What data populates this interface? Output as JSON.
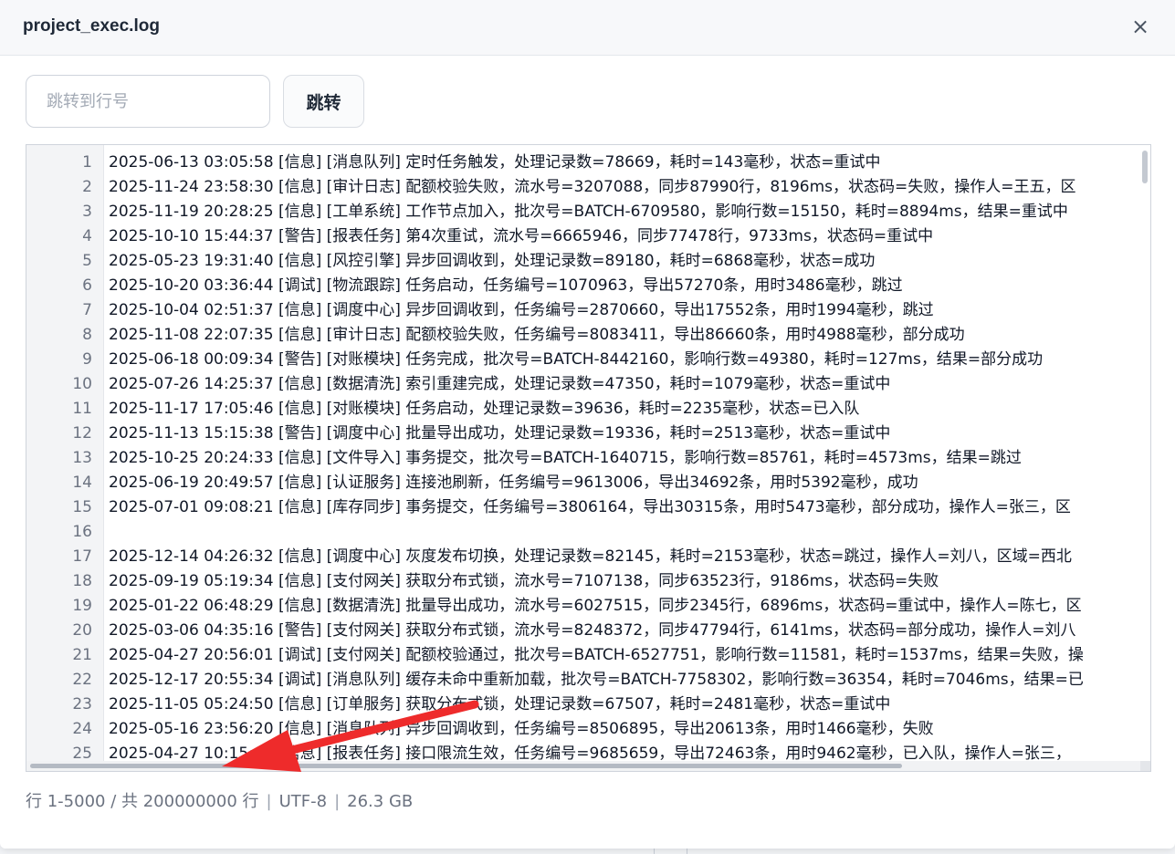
{
  "dialog": {
    "title": "project_exec.log",
    "close_glyph": "×"
  },
  "jump": {
    "placeholder": "跳转到行号",
    "button_label": "跳转"
  },
  "log_lines": [
    {
      "n": "1",
      "text": "2025-06-13 03:05:58 [信息] [消息队列] 定时任务触发，处理记录数=78669，耗时=143毫秒，状态=重试中"
    },
    {
      "n": "2",
      "text": "2025-11-24 23:58:30 [信息] [审计日志] 配额校验失败，流水号=3207088，同步87990行，8196ms，状态码=失败，操作人=王五，区"
    },
    {
      "n": "3",
      "text": "2025-11-19 20:28:25 [信息] [工单系统] 工作节点加入，批次号=BATCH-6709580，影响行数=15150，耗时=8894ms，结果=重试中"
    },
    {
      "n": "4",
      "text": "2025-10-10 15:44:37 [警告] [报表任务] 第4次重试，流水号=6665946，同步77478行，9733ms，状态码=重试中"
    },
    {
      "n": "5",
      "text": "2025-05-23 19:31:40 [信息] [风控引擎] 异步回调收到，处理记录数=89180，耗时=6868毫秒，状态=成功"
    },
    {
      "n": "6",
      "text": "2025-10-20 03:36:44 [调试] [物流跟踪] 任务启动，任务编号=1070963，导出57270条，用时3486毫秒，跳过"
    },
    {
      "n": "7",
      "text": "2025-10-04 02:51:37 [信息] [调度中心] 异步回调收到，任务编号=2870660，导出17552条，用时1994毫秒，跳过"
    },
    {
      "n": "8",
      "text": "2025-11-08 22:07:35 [信息] [审计日志] 配额校验失败，任务编号=8083411，导出86660条，用时4988毫秒，部分成功"
    },
    {
      "n": "9",
      "text": "2025-06-18 00:09:34 [警告] [对账模块] 任务完成，批次号=BATCH-8442160，影响行数=49380，耗时=127ms，结果=部分成功"
    },
    {
      "n": "10",
      "text": "2025-07-26 14:25:37 [信息] [数据清洗] 索引重建完成，处理记录数=47350，耗时=1079毫秒，状态=重试中"
    },
    {
      "n": "11",
      "text": "2025-11-17 17:05:46 [信息] [对账模块] 任务启动，处理记录数=39636，耗时=2235毫秒，状态=已入队"
    },
    {
      "n": "12",
      "text": "2025-11-13 15:15:38 [警告] [调度中心] 批量导出成功，处理记录数=19336，耗时=2513毫秒，状态=重试中"
    },
    {
      "n": "13",
      "text": "2025-10-25 20:24:33 [信息] [文件导入] 事务提交，批次号=BATCH-1640715，影响行数=85761，耗时=4573ms，结果=跳过"
    },
    {
      "n": "14",
      "text": "2025-06-19 20:49:57 [信息] [认证服务] 连接池刷新，任务编号=9613006，导出34692条，用时5392毫秒，成功"
    },
    {
      "n": "15",
      "text": "2025-07-01 09:08:21 [信息] [库存同步] 事务提交，任务编号=3806164，导出30315条，用时5473毫秒，部分成功，操作人=张三，区"
    },
    {
      "n": "16",
      "text": ""
    },
    {
      "n": "17",
      "text": "2025-12-14 04:26:32 [信息] [调度中心] 灰度发布切换，处理记录数=82145，耗时=2153毫秒，状态=跳过，操作人=刘八，区域=西北"
    },
    {
      "n": "18",
      "text": "2025-09-19 05:19:34 [信息] [支付网关] 获取分布式锁，流水号=7107138，同步63523行，9186ms，状态码=失败"
    },
    {
      "n": "19",
      "text": "2025-01-22 06:48:29 [信息] [数据清洗] 批量导出成功，流水号=6027515，同步2345行，6896ms，状态码=重试中，操作人=陈七，区"
    },
    {
      "n": "20",
      "text": "2025-03-06 04:35:16 [警告] [支付网关] 获取分布式锁，流水号=8248372，同步47794行，6141ms，状态码=部分成功，操作人=刘八"
    },
    {
      "n": "21",
      "text": "2025-04-27 20:56:01 [调试] [支付网关] 配额校验通过，批次号=BATCH-6527751，影响行数=11581，耗时=1537ms，结果=失败，操"
    },
    {
      "n": "22",
      "text": "2025-12-17 20:55:34 [调试] [消息队列] 缓存未命中重新加载，批次号=BATCH-7758302，影响行数=36354，耗时=7046ms，结果=已"
    },
    {
      "n": "23",
      "text": "2025-11-05 05:24:50 [信息] [订单服务] 获取分布式锁，处理记录数=67507，耗时=2481毫秒，状态=重试中"
    },
    {
      "n": "24",
      "text": "2025-05-16 23:56:20 [信息] [消息队列] 异步回调收到，任务编号=8506895，导出20613条，用时1466毫秒，失败"
    },
    {
      "n": "25",
      "text": "2025-04-27 10:15:08 [信息] [报表任务] 接口限流生效，任务编号=9685659，导出72463条，用时9462毫秒，已入队，操作人=张三，"
    }
  ],
  "status": {
    "range": "行 1-5000 / 共 200000000 行",
    "encoding": "UTF-8",
    "size": "26.3 GB",
    "separator": "|"
  },
  "annotation": {
    "arrow_color": "#ee2b2b"
  }
}
